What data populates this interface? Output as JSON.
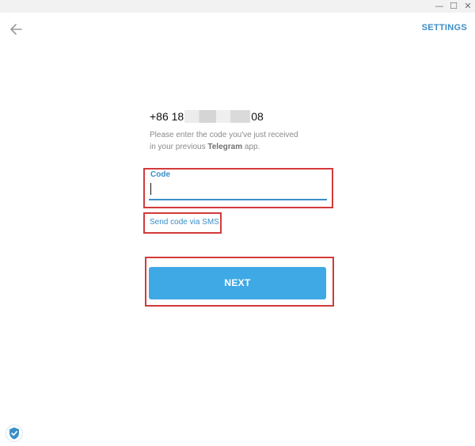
{
  "titlebar": {
    "minimize_glyph": "—",
    "maximize_glyph": "☐",
    "close_glyph": "✕"
  },
  "header": {
    "back_icon": "arrow-left-icon",
    "settings_label": "SETTINGS"
  },
  "login": {
    "phone_prefix": "+86 18",
    "phone_suffix": "08",
    "hint_line1": "Please enter the code you've just received",
    "hint_line2_pre": "in your previous ",
    "hint_line2_bold": "Telegram",
    "hint_line2_post": " app.",
    "code_label": "Code",
    "code_value": "",
    "sms_link": "Send code via SMS",
    "next_label": "NEXT"
  },
  "footer": {
    "shield_icon": "shield-check-icon"
  },
  "colors": {
    "accent": "#3a8ec7",
    "button": "#3fa9e6",
    "highlight": "#d33a3a"
  }
}
